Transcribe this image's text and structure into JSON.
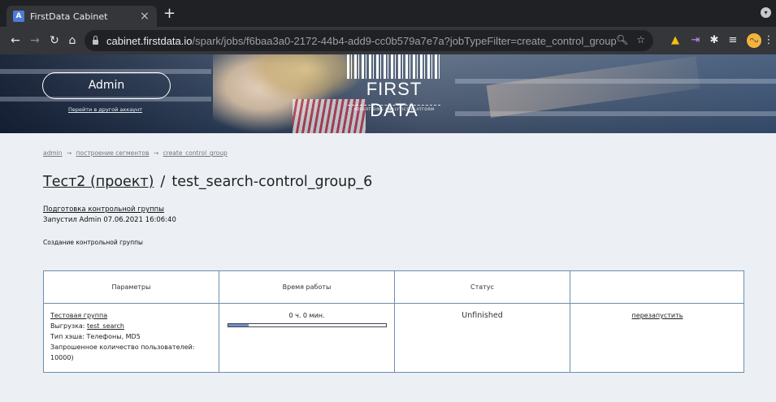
{
  "browser": {
    "tab_title": "FirstData Cabinet",
    "tab_favicon_letter": "A",
    "tab_close": "×",
    "new_tab": "+",
    "url_host": "cabinet.firstdata.io",
    "url_path": "/spark/jobs/f6baa3a0-2172-44b4-add9-cc0b579a7e7a?jobTypeFilter=create_control_group",
    "avatar_label": "ᴖᴗ"
  },
  "header": {
    "account_name": "Admin",
    "switch_account_label": "Перейти в другой аккаунт",
    "logo_text": "FIRST DATA",
    "logo_tagline": "ADVERTISING ANALYTICS PLATFORM"
  },
  "breadcrumb": [
    "admin",
    "построение сегментов",
    "create_control_group"
  ],
  "breadcrumb_separator": "→",
  "page": {
    "project_link": "Тест2 (проект)",
    "title_separator": "/",
    "job_name": "test_search-control_group_6",
    "task_link": "Подготовка контрольной группы",
    "launched_info": "Запустил Admin 07.06.2021 16:06:40",
    "description": "Создание контрольной группы"
  },
  "table": {
    "headers": [
      "Параметры",
      "Время работы",
      "Статус",
      ""
    ],
    "row": {
      "group_link": "Тестовая группа",
      "export_label": "Выгрузка: ",
      "export_link": "test_search",
      "hash_type": "Тип хэша: Телефоны, MD5",
      "requested_users": "Запрошенное количество пользователей: 10000)",
      "runtime": "0 ч. 0 мин.",
      "progress_fraction": 0.13,
      "status": "Unfinished",
      "action": "перезапустить"
    }
  }
}
